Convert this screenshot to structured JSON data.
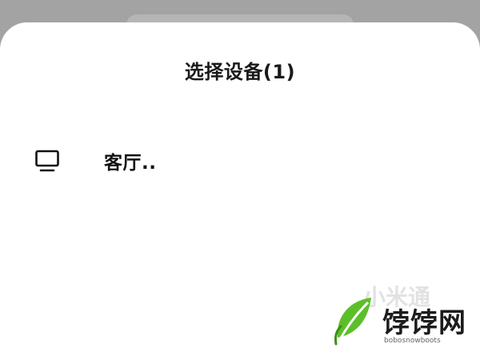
{
  "sheet": {
    "title": "选择设备(1)"
  },
  "devices": [
    {
      "icon": "tv-icon",
      "name": "客厅.."
    }
  ],
  "watermark": {
    "faint_text": "小米通",
    "brand": "饽饽网",
    "url": "bobosnowboots"
  },
  "colors": {
    "backdrop": "#a3a3a3",
    "sheet_background": "#ffffff",
    "text": "#111111",
    "watermark_green": "#5cbf2a"
  }
}
